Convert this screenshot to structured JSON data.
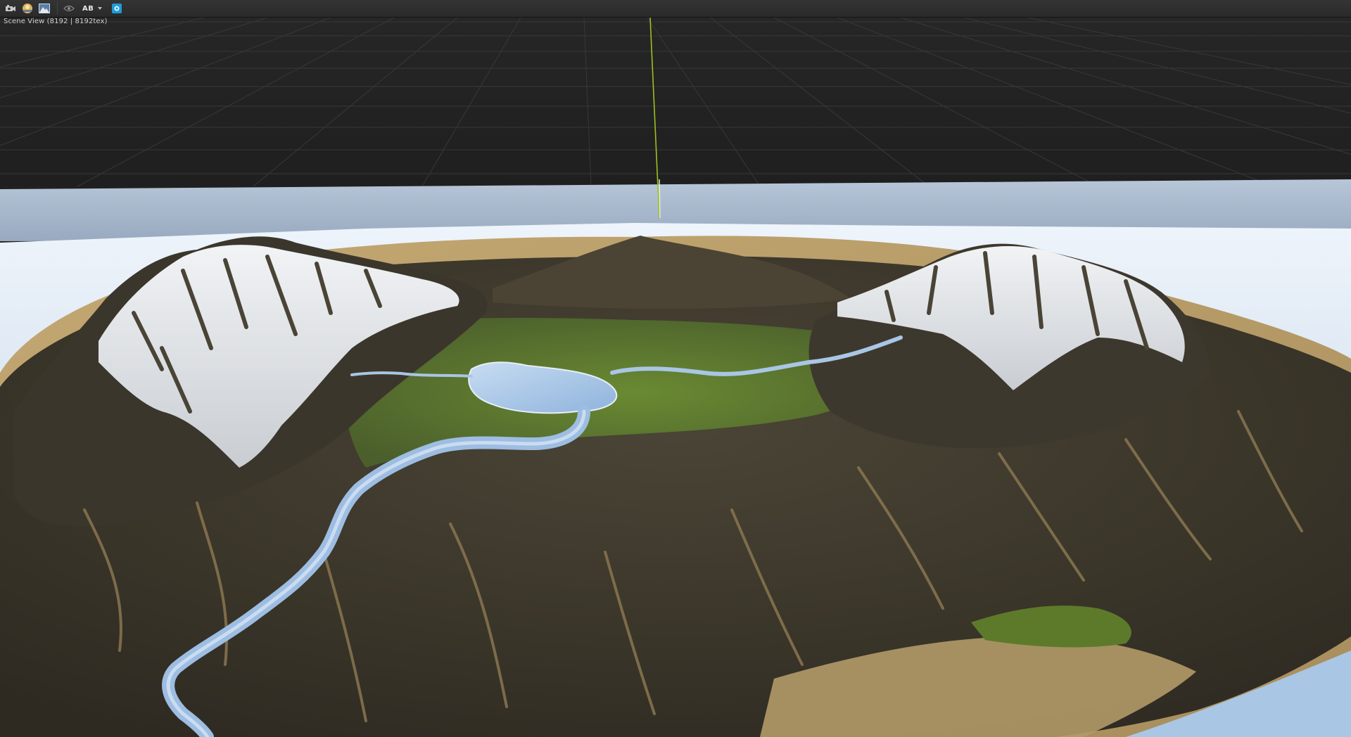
{
  "toolbar": {
    "buttons": [
      {
        "id": "view-options",
        "icon": "camera-settings-icon"
      },
      {
        "id": "lighting",
        "icon": "sun-sky-icon"
      },
      {
        "id": "render-preview",
        "icon": "landscape-image-icon"
      },
      {
        "id": "visibility",
        "icon": "eye-icon"
      }
    ],
    "ab_compare_label": "AB",
    "capture_icon": "camera-capture-icon",
    "accent_color": "#1e9bd7"
  },
  "viewport": {
    "title": "Scene View (8192 | 8192tex)",
    "background_color": "#232323",
    "grid_color": "#3a3a3a",
    "axis_color": "#9cc021"
  },
  "terrain": {
    "features": [
      "snow-capped-peak-left",
      "snow-capped-peak-right",
      "central-hill",
      "alpine-lake",
      "river",
      "grassy-valley"
    ],
    "colors": {
      "snow": "#e4e6e8",
      "rock": "#3f3a30",
      "grass": "#5f7f2c",
      "sand": "#b39a68",
      "water": "#aac8e8",
      "ground_plane": "#d2e2f3",
      "horizon": "#a9bacd"
    }
  }
}
